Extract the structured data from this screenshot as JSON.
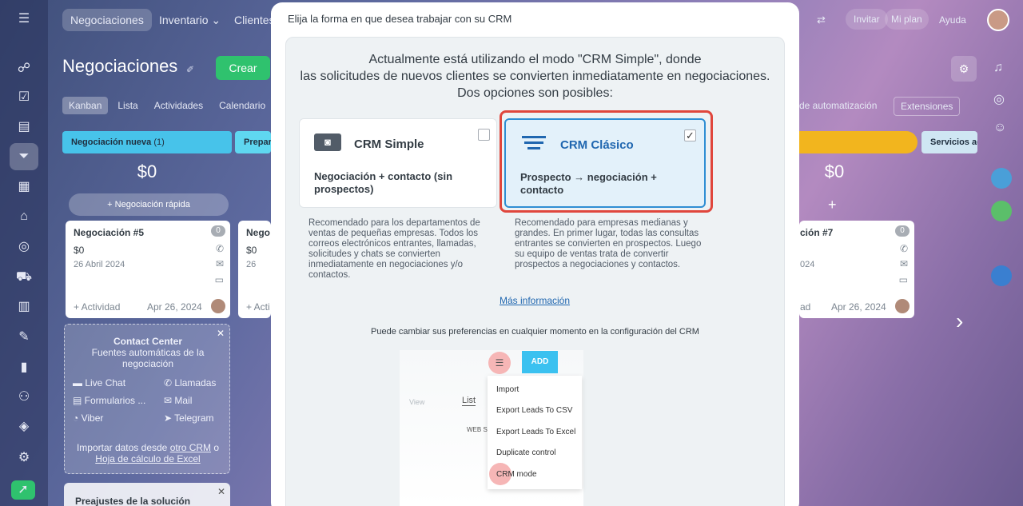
{
  "topbar": {
    "tabs": [
      "Negociaciones",
      "Inventario ⌄",
      "Clientes"
    ],
    "right": [
      "Invitar",
      "Mi plan",
      "Ayuda"
    ]
  },
  "page": {
    "title": "Negociaciones",
    "create_button": "Crear",
    "view_tabs": [
      "Kanban",
      "Lista",
      "Actividades",
      "Calendario"
    ],
    "right_tabs": [
      "de automatización",
      "Extensiones"
    ]
  },
  "columns": {
    "new": {
      "title": "Negociación nueva",
      "count": "(1)",
      "sum": "$0",
      "quick_add": "+ Negociación rápida"
    },
    "prep": {
      "title": "Prepar"
    },
    "right_sum": "$0",
    "services": {
      "title": "Servicios ad"
    }
  },
  "deal_card": {
    "title": "Negociación #5",
    "amount": "$0",
    "date": "26 Abril 2024",
    "activity": "+ Actividad",
    "date_short": "Apr 26, 2024",
    "badge": "0"
  },
  "deal_card2": {
    "title": "Nego",
    "amount": "$0",
    "date": "26",
    "activity": "+ Acti"
  },
  "deal_card3": {
    "title": "ción #7",
    "date": "024",
    "activity": "ad",
    "date_short": "Apr 26, 2024",
    "badge": "0"
  },
  "contact_center": {
    "title": "Contact Center",
    "subtitle": "Fuentes automáticas de la negociación",
    "items": [
      "Live Chat",
      "Llamadas",
      "Formularios ...",
      "Mail",
      "Viber",
      "Telegram"
    ],
    "import_text": "Importar datos desde",
    "import_link1": "otro CRM",
    "import_or": "o",
    "import_link2": "Hoja de cálculo de Excel"
  },
  "presets": {
    "title": "Preajustes de la solución"
  },
  "modal": {
    "title": "Elija la forma en que desea trabajar con su CRM",
    "intro_line1": "Actualmente está utilizando el modo \"CRM Simple\", donde",
    "intro_line2": "las solicitudes de nuevos clientes se convierten inmediatamente en negociaciones.",
    "intro_line3": "Dos opciones son posibles:",
    "simple": {
      "title": "CRM Simple",
      "subtitle": "Negociación + contacto (sin prospectos)",
      "description": "Recomendado para los departamentos de ventas de pequeñas empresas. Todos los correos electrónicos entrantes, llamadas, solicitudes y chats se convierten inmediatamente en negociaciones y/o contactos.",
      "checked": false
    },
    "classic": {
      "title": "CRM Clásico",
      "subtitle": "Prospecto → negociación + contacto",
      "description": "Recomendado para empresas medianas y grandes. En primer lugar, todas las consultas entrantes se convierten en prospectos. Luego su equipo de ventas trata de convertir prospectos a negociaciones y contactos.",
      "checked": true
    },
    "more_info": "Más información",
    "note": "Puede cambiar sus preferencias en cualquier momento en la configuración del CRM",
    "illustration": {
      "add_button": "ADD",
      "view_label": "View",
      "list_label": "List",
      "web_label": "WEB S",
      "menu": [
        "Import",
        "Export Leads To CSV",
        "Export Leads To Excel",
        "Duplicate control",
        "CRM mode"
      ]
    }
  },
  "colors": {
    "accent": "#2fc26e",
    "classic_blue": "#2067b0",
    "highlight": "#e0463c"
  }
}
